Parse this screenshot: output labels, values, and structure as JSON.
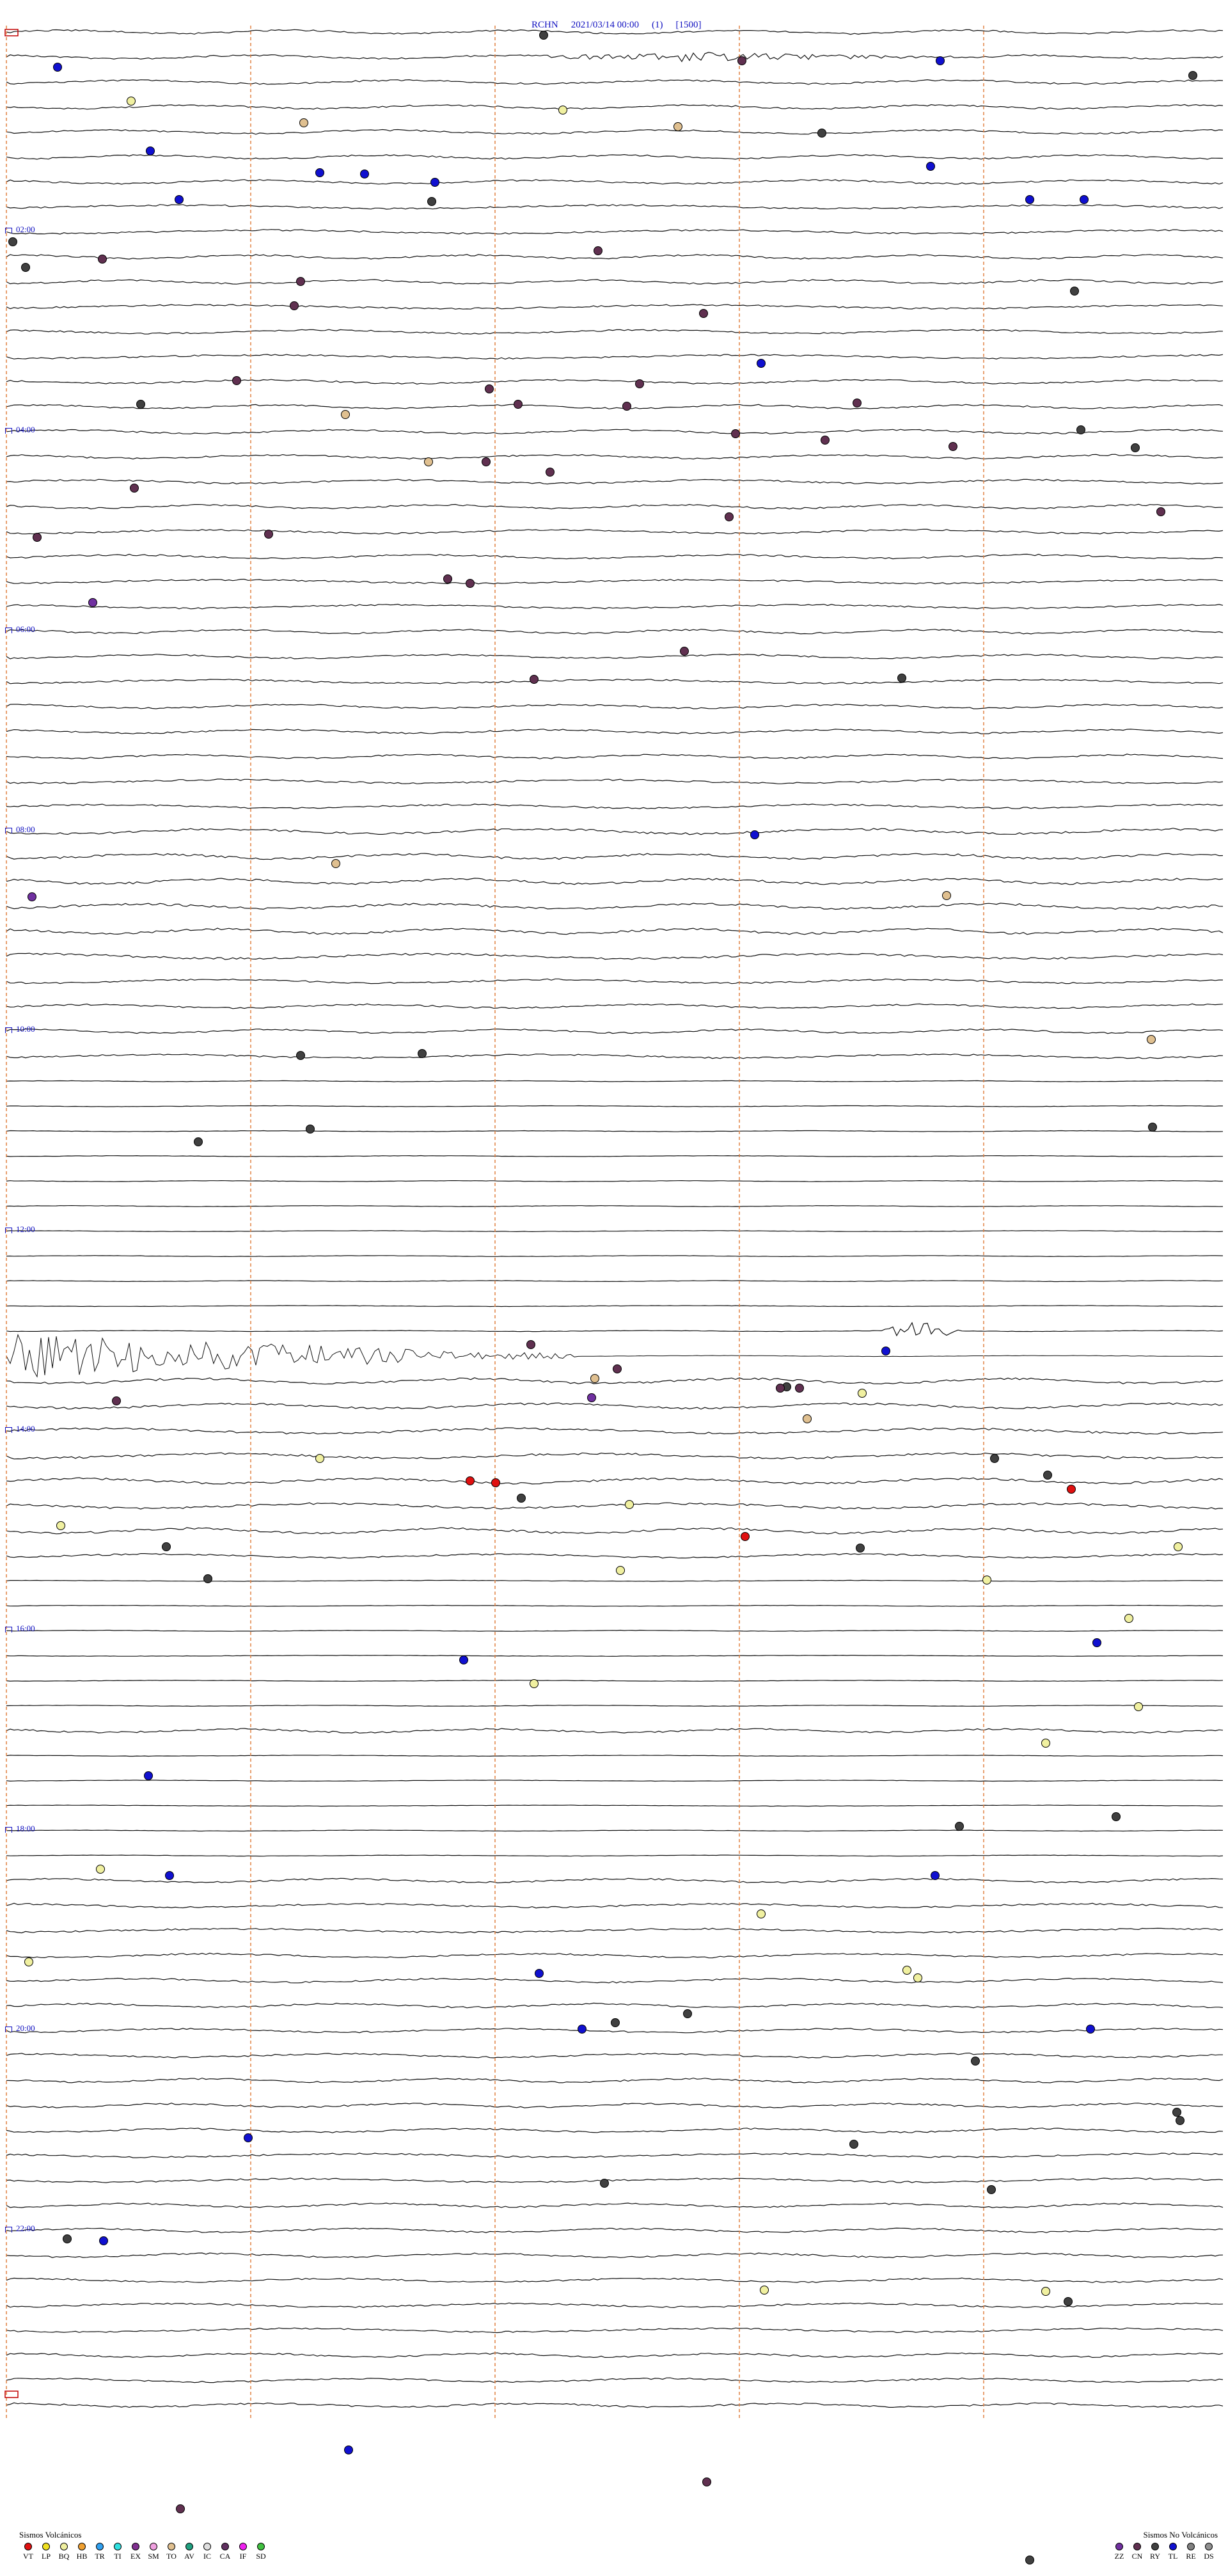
{
  "header": {
    "station": "RCHN",
    "datetime": "2021/03/14 00:00",
    "channel": "(1)",
    "scale": "[1500]"
  },
  "hour_labels": [
    "02:00",
    "04:00",
    "06:00",
    "08:00",
    "10:00",
    "12:00",
    "14:00",
    "16:00",
    "18:00",
    "20:00",
    "22:00"
  ],
  "legend_volcanic": {
    "title": "Sismos Volcánicos",
    "items": [
      {
        "code": "VT",
        "color": "#e01010"
      },
      {
        "code": "LP",
        "color": "#f0e020"
      },
      {
        "code": "BQ",
        "color": "#f0f0a0"
      },
      {
        "code": "HB",
        "color": "#f0a030"
      },
      {
        "code": "TR",
        "color": "#30a0f0"
      },
      {
        "code": "TI",
        "color": "#30e0e0"
      },
      {
        "code": "EX",
        "color": "#803090"
      },
      {
        "code": "SM",
        "color": "#f0a0e0"
      },
      {
        "code": "TO",
        "color": "#e0c090"
      },
      {
        "code": "AV",
        "color": "#20a080"
      },
      {
        "code": "IC",
        "color": "#e0e0e0"
      },
      {
        "code": "CA",
        "color": "#603060"
      },
      {
        "code": "IF",
        "color": "#f020f0"
      },
      {
        "code": "SD",
        "color": "#40c040"
      }
    ]
  },
  "legend_nonvolcanic": {
    "title": "Sismos No Volcánicos",
    "items": [
      {
        "code": "ZZ",
        "color": "#7030a0"
      },
      {
        "code": "CN",
        "color": "#603050"
      },
      {
        "code": "RY",
        "color": "#404040"
      },
      {
        "code": "TL",
        "color": "#1010d0"
      },
      {
        "code": "RE",
        "color": "#808080"
      },
      {
        "code": "DS",
        "color": "#909090"
      }
    ]
  },
  "colors": {
    "trace": "#111111",
    "dashed_guides": "#e08040",
    "labels": "#1010c0"
  }
}
